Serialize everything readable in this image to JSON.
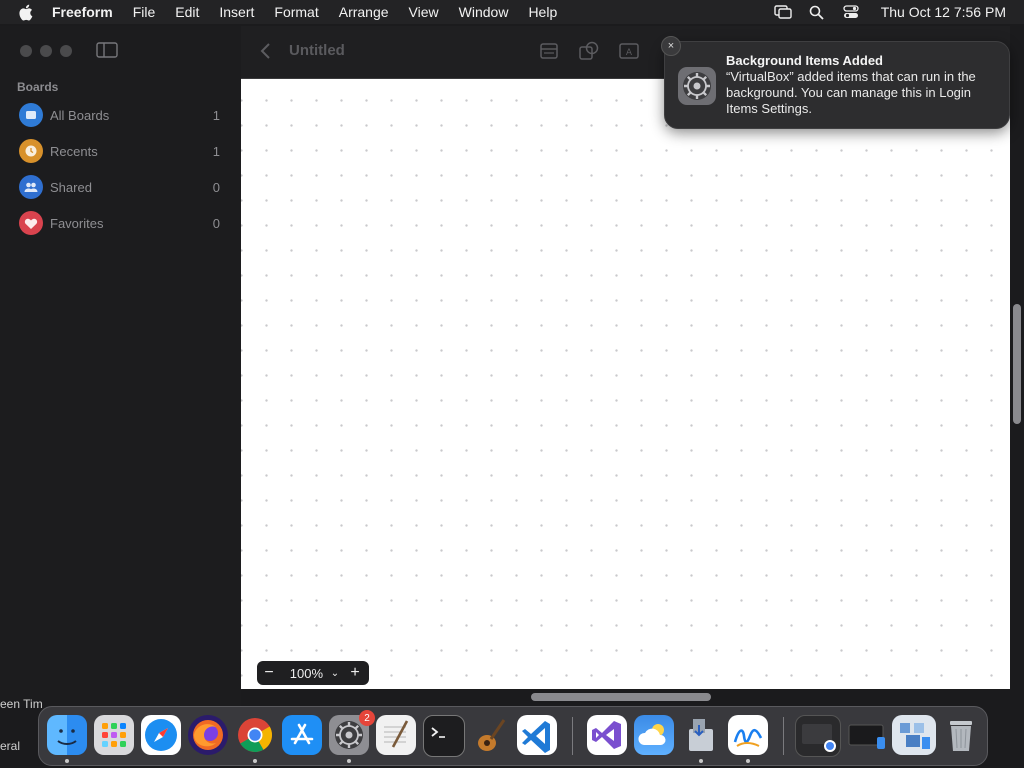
{
  "menubar": {
    "app_name": "Freeform",
    "items": [
      "File",
      "Edit",
      "Insert",
      "Format",
      "Arrange",
      "View",
      "Window",
      "Help"
    ],
    "clock": "Thu Oct 12  7:56 PM"
  },
  "sidebar": {
    "heading": "Boards",
    "items": [
      {
        "label": "All Boards",
        "count": "1",
        "color": "#2f7bd6"
      },
      {
        "label": "Recents",
        "count": "1",
        "color": "#d8912b"
      },
      {
        "label": "Shared",
        "count": "0",
        "color": "#2f6fd0"
      },
      {
        "label": "Favorites",
        "count": "0",
        "color": "#d9434e"
      }
    ]
  },
  "toolbar": {
    "title": "Untitled"
  },
  "zoom": {
    "minus": "−",
    "value": "100%",
    "chevron": "⌄",
    "plus": "+"
  },
  "notification": {
    "close": "×",
    "title": "Background Items Added",
    "body": "“VirtualBox” added items that can run in the background. You can manage this in Login Items Settings."
  },
  "edge": {
    "line1": "een Tim",
    "line2": "eral"
  },
  "dock": {
    "items": [
      {
        "name": "Finder",
        "color": "#2c8cf0",
        "running": true
      },
      {
        "name": "Launchpad",
        "color": "#d6d6d6",
        "running": false
      },
      {
        "name": "Safari",
        "color": "#1c8ef1",
        "running": false
      },
      {
        "name": "Firefox",
        "color": "#f06a24",
        "running": false
      },
      {
        "name": "Chrome",
        "color": "#ffffff",
        "running": true
      },
      {
        "name": "App Store",
        "color": "#1f8ff5",
        "running": false
      },
      {
        "name": "System Settings",
        "color": "#8e8e93",
        "running": true,
        "badge": "2"
      },
      {
        "name": "TextEdit",
        "color": "#f1f1f1",
        "running": false
      },
      {
        "name": "Terminal",
        "color": "#222222",
        "running": false
      },
      {
        "name": "Instruments",
        "color": "#3a2a1a",
        "running": false
      },
      {
        "name": "Visual Studio Code",
        "color": "#1f7ad6",
        "running": false
      },
      {
        "name": "Visual Studio",
        "color": "#7a4fcf",
        "running": false
      },
      {
        "name": "Weather",
        "color": "#3b8be6",
        "running": false
      },
      {
        "name": "Installer",
        "color": "#d0d6de",
        "running": true
      },
      {
        "name": "Freeform",
        "color": "#ffffff",
        "running": true
      },
      {
        "name": "Downloads",
        "color": "#2a2a2c",
        "running": false
      },
      {
        "name": "Applications",
        "color": "#2a2a2c",
        "running": false
      },
      {
        "name": "Documents",
        "color": "#dfe6ee",
        "running": false
      },
      {
        "name": "Trash",
        "color": "#bfc3c8",
        "running": false
      }
    ]
  }
}
